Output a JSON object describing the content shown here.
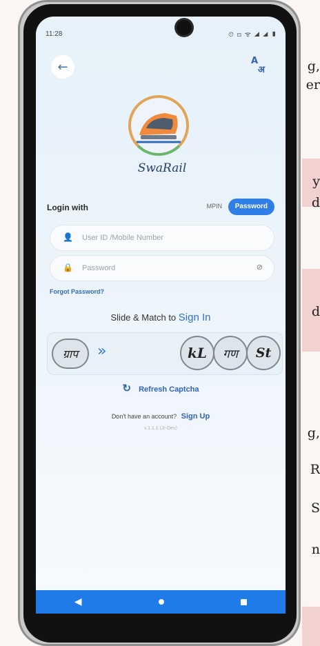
{
  "background_doc": {
    "fragments": [
      {
        "text": "g,"
      },
      {
        "text": "er"
      },
      {
        "text": "y"
      },
      {
        "text": "d"
      },
      {
        "text": "d"
      },
      {
        "text": "g,"
      },
      {
        "text": "R"
      },
      {
        "text": "S"
      },
      {
        "text": "n"
      }
    ]
  },
  "status_bar": {
    "time": "11:28",
    "icons_text": "⏲ ⊡ ᯤ ◢ ◢ ▮"
  },
  "header": {
    "back_icon": "arrow-left-icon",
    "back_glyph": "←",
    "lang_icon": "translate-icon",
    "lang_glyph_top": "A",
    "lang_glyph_bottom": "अ"
  },
  "logo": {
    "name": "SwaRail"
  },
  "login": {
    "label": "Login with",
    "mpin_label": "MPIN",
    "password_label": "Password"
  },
  "fields": {
    "user": {
      "placeholder": "User ID /Mobile Number",
      "icon": "person-icon",
      "glyph": "👤"
    },
    "password": {
      "placeholder": "Password",
      "icon": "lock-icon",
      "glyph": "🔒",
      "eye_icon": "eye-off-icon",
      "eye_glyph": "⊘"
    }
  },
  "forgot_password": "Forgot Password?",
  "captcha": {
    "caption_prefix": "Slide & Match to",
    "caption_action": "Sign In",
    "slider_text": "ग्राप",
    "chevrons": "»",
    "options": [
      "kL",
      "गण",
      "St"
    ],
    "refresh_glyph": "↻",
    "refresh_label": "Refresh Captcha"
  },
  "signup": {
    "prompt": "Don't have an account?",
    "link": "Sign Up",
    "version": "v.1.1.1 (Jr-Dev)"
  },
  "colors": {
    "primary": "#2f7fe6",
    "navbar": "#1f7be8",
    "screen_bg": "#e6f1f9"
  }
}
